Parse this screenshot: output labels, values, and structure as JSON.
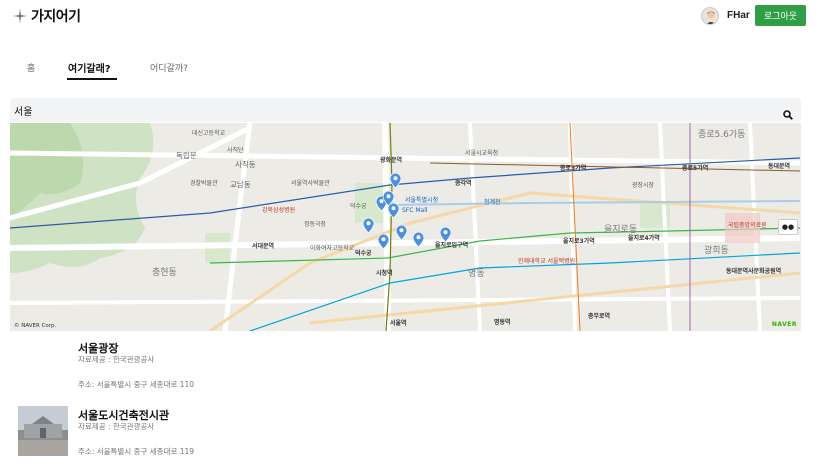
{
  "app": {
    "logo_text": "가지어기",
    "user_name": "FHar",
    "logout_label": "로그아웃"
  },
  "tabs": [
    {
      "label": "홈",
      "active": false
    },
    {
      "label": "여기갈래?",
      "active": true
    },
    {
      "label": "어디갈까?",
      "active": false
    }
  ],
  "search": {
    "value": "서울",
    "icon": "search-icon"
  },
  "map": {
    "copyright": "© NAVER Corp.",
    "brand": "NAVER",
    "areas": [
      "종로5.6가동",
      "을지로동",
      "광희동",
      "충현동",
      "명동",
      "사직동",
      "교남동"
    ],
    "stations": [
      "광화문역",
      "종각역",
      "종로3가역",
      "종로5가역",
      "동대문역",
      "을지로입구역",
      "을지로3가역",
      "을지로4가역",
      "동대문역사문화공원역",
      "서대문역",
      "시청역",
      "덕수궁",
      "명동역",
      "충무로역",
      "서울역"
    ],
    "places": [
      "독립문",
      "대신고등학교",
      "서울특별시청",
      "SFC Mall",
      "인제대학교 서울백병원",
      "국립중앙의료원",
      "경찰박물관",
      "강북삼성병원",
      "서울시교육청",
      "서울역사박물관",
      "정동극장",
      "사직단",
      "덕수궁",
      "이화여자고등학교",
      "청계천",
      "광장시장"
    ],
    "accent": "#4a90e2"
  },
  "results": [
    {
      "title": "서울광장",
      "source": "자료제공 : 한국관광공사",
      "address": "주소: 서울특별시 중구 세종대로 110",
      "has_thumb": false
    },
    {
      "title": "서울도시건축전시관",
      "source": "자료제공 : 한국관광공사",
      "address": "주소: 서울특별시 중구 세종대로 119",
      "has_thumb": true
    }
  ]
}
